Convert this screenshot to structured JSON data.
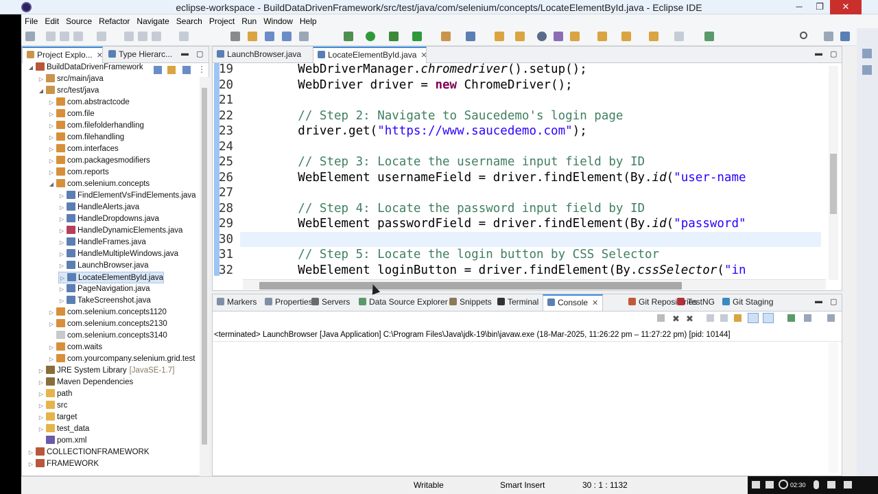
{
  "window": {
    "title": "eclipse-workspace - BuildDataDrivenFramework/src/test/java/com/selenium/concepts/LocateElementById.java - Eclipse IDE",
    "min": "─",
    "restore": "❐",
    "close": "✕"
  },
  "menu": [
    "File",
    "Edit",
    "Source",
    "Refactor",
    "Navigate",
    "Search",
    "Project",
    "Run",
    "Window",
    "Help"
  ],
  "left_panel": {
    "tabs": [
      {
        "label": "Project Explo...",
        "close": "✕"
      },
      {
        "label": "Type Hierarc..."
      }
    ],
    "tree": [
      {
        "label": "BuildDataDrivenFramework",
        "indent": 0,
        "twisty": "◢",
        "icon": "#b8573a"
      },
      {
        "label": "src/main/java",
        "indent": 1,
        "twisty": "▷",
        "icon": "#c9954a"
      },
      {
        "label": "src/test/java",
        "indent": 1,
        "twisty": "◢",
        "icon": "#c9954a"
      },
      {
        "label": "com.abstractcode",
        "indent": 2,
        "twisty": "▷",
        "icon": "#d88f3a"
      },
      {
        "label": "com.file",
        "indent": 2,
        "twisty": "▷",
        "icon": "#d88f3a"
      },
      {
        "label": "com.filefolderhandling",
        "indent": 2,
        "twisty": "▷",
        "icon": "#d88f3a"
      },
      {
        "label": "com.filehandling",
        "indent": 2,
        "twisty": "▷",
        "icon": "#d88f3a"
      },
      {
        "label": "com.interfaces",
        "indent": 2,
        "twisty": "▷",
        "icon": "#d88f3a"
      },
      {
        "label": "com.packagesmodifiers",
        "indent": 2,
        "twisty": "▷",
        "icon": "#d88f3a"
      },
      {
        "label": "com.reports",
        "indent": 2,
        "twisty": "▷",
        "icon": "#d88f3a"
      },
      {
        "label": "com.selenium.concepts",
        "indent": 2,
        "twisty": "◢",
        "icon": "#d88f3a"
      },
      {
        "label": "FindElementVsFindElements.java",
        "indent": 3,
        "twisty": "▷",
        "icon": "#5b7fb5"
      },
      {
        "label": "HandleAlerts.java",
        "indent": 3,
        "twisty": "▷",
        "icon": "#5b7fb5"
      },
      {
        "label": "HandleDropdowns.java",
        "indent": 3,
        "twisty": "▷",
        "icon": "#5b7fb5"
      },
      {
        "label": "HandleDynamicElements.java",
        "indent": 3,
        "twisty": "▷",
        "icon": "#b5405b"
      },
      {
        "label": "HandleFrames.java",
        "indent": 3,
        "twisty": "▷",
        "icon": "#5b7fb5"
      },
      {
        "label": "HandleMultipleWindows.java",
        "indent": 3,
        "twisty": "▷",
        "icon": "#5b7fb5"
      },
      {
        "label": "LaunchBrowser.java",
        "indent": 3,
        "twisty": "▷",
        "icon": "#5b7fb5"
      },
      {
        "label": "LocateElementById.java",
        "indent": 3,
        "twisty": "▷",
        "icon": "#5b7fb5",
        "selected": true
      },
      {
        "label": "PageNavigation.java",
        "indent": 3,
        "twisty": "▷",
        "icon": "#5b7fb5"
      },
      {
        "label": "TakeScreenshot.java",
        "indent": 3,
        "twisty": "▷",
        "icon": "#5b7fb5"
      },
      {
        "label": "com.selenium.concepts1120",
        "indent": 2,
        "twisty": "▷",
        "icon": "#d88f3a"
      },
      {
        "label": "com.selenium.concepts2130",
        "indent": 2,
        "twisty": "▷",
        "icon": "#d88f3a"
      },
      {
        "label": "com.selenium.concepts3140",
        "indent": 2,
        "twisty": "",
        "icon": "#c9c9c9"
      },
      {
        "label": "com.waits",
        "indent": 2,
        "twisty": "▷",
        "icon": "#d88f3a"
      },
      {
        "label": "com.yourcompany.selenium.grid.test",
        "indent": 2,
        "twisty": "▷",
        "icon": "#d88f3a"
      },
      {
        "label": "JRE System Library",
        "dim": "[JavaSE-1.7]",
        "indent": 1,
        "twisty": "▷",
        "icon": "#8a6d3b"
      },
      {
        "label": "Maven Dependencies",
        "indent": 1,
        "twisty": "▷",
        "icon": "#8a6d3b"
      },
      {
        "label": "path",
        "indent": 1,
        "twisty": "▷",
        "icon": "#e6b44a"
      },
      {
        "label": "src",
        "indent": 1,
        "twisty": "▷",
        "icon": "#e6b44a"
      },
      {
        "label": "target",
        "indent": 1,
        "twisty": "▷",
        "icon": "#e6b44a"
      },
      {
        "label": "test_data",
        "indent": 1,
        "twisty": "▷",
        "icon": "#e6b44a"
      },
      {
        "label": "pom.xml",
        "indent": 1,
        "twisty": "",
        "icon": "#6a5aa8"
      },
      {
        "label": "COLLECTIONFRAMEWORK",
        "indent": 0,
        "twisty": "▷",
        "icon": "#b8573a"
      },
      {
        "label": "FRAMEWORK",
        "indent": 0,
        "twisty": "▷",
        "icon": "#b8573a"
      }
    ]
  },
  "editor": {
    "tabs": [
      {
        "label": "LaunchBrowser.java"
      },
      {
        "label": "LocateElementById.java",
        "close": "✕"
      }
    ],
    "lines": [
      {
        "num": "19",
        "parts": [
          {
            "t": "        WebDriverManager."
          },
          {
            "t": "chromedriver",
            "c": "ital"
          },
          {
            "t": "().setup();"
          }
        ]
      },
      {
        "num": "20",
        "parts": [
          {
            "t": "        WebDriver driver = "
          },
          {
            "t": "new",
            "c": "kw"
          },
          {
            "t": " ChromeDriver();"
          }
        ]
      },
      {
        "num": "21",
        "parts": [
          {
            "t": ""
          }
        ]
      },
      {
        "num": "22",
        "parts": [
          {
            "t": "        "
          },
          {
            "t": "// Step 2: Navigate to Saucedemo's login page",
            "c": "comment"
          }
        ]
      },
      {
        "num": "23",
        "parts": [
          {
            "t": "        driver.get("
          },
          {
            "t": "\"https://www.saucedemo.com\"",
            "c": "str"
          },
          {
            "t": ");"
          }
        ]
      },
      {
        "num": "24",
        "parts": [
          {
            "t": ""
          }
        ]
      },
      {
        "num": "25",
        "parts": [
          {
            "t": "        "
          },
          {
            "t": "// Step 3: Locate the username input field by ID",
            "c": "comment"
          }
        ]
      },
      {
        "num": "26",
        "parts": [
          {
            "t": "        WebElement usernameField = driver.findElement(By."
          },
          {
            "t": "id",
            "c": "ital"
          },
          {
            "t": "("
          },
          {
            "t": "\"user-name",
            "c": "str"
          }
        ]
      },
      {
        "num": "27",
        "parts": [
          {
            "t": ""
          }
        ]
      },
      {
        "num": "28",
        "parts": [
          {
            "t": "        "
          },
          {
            "t": "// Step 4: Locate the password input field by ID",
            "c": "comment"
          }
        ]
      },
      {
        "num": "29",
        "parts": [
          {
            "t": "        WebElement passwordField = driver.findElement(By."
          },
          {
            "t": "id",
            "c": "ital"
          },
          {
            "t": "("
          },
          {
            "t": "\"password\"",
            "c": "str"
          }
        ]
      },
      {
        "num": "30",
        "parts": [
          {
            "t": ""
          }
        ],
        "current": true
      },
      {
        "num": "31",
        "parts": [
          {
            "t": "        "
          },
          {
            "t": "// Step 5: Locate the login button by CSS Selector",
            "c": "comment"
          }
        ]
      },
      {
        "num": "32",
        "parts": [
          {
            "t": "        WebElement loginButton = driver.findElement(By."
          },
          {
            "t": "cssSelector",
            "c": "ital"
          },
          {
            "t": "("
          },
          {
            "t": "\"in",
            "c": "str"
          }
        ]
      }
    ]
  },
  "bottom_panel": {
    "tabs": [
      {
        "label": "Markers"
      },
      {
        "label": "Properties"
      },
      {
        "label": "Servers"
      },
      {
        "label": "Data Source Explorer"
      },
      {
        "label": "Snippets"
      },
      {
        "label": "Terminal"
      },
      {
        "label": "Console",
        "close": "✕",
        "active": true
      },
      {
        "label": "Git Repositories"
      },
      {
        "label": "TestNG"
      },
      {
        "label": "Git Staging"
      }
    ],
    "console_header": "<terminated> LaunchBrowser [Java Application] C:\\Program Files\\Java\\jdk-19\\bin\\javaw.exe  (18-Mar-2025, 11:26:22 pm – 11:27:22 pm) [pid: 10144]"
  },
  "status": {
    "writable": "Writable",
    "insert_mode": "Smart Insert",
    "position": "30 : 1 : 1132"
  },
  "tray": {
    "time": "02:30"
  },
  "colors": {
    "accent": "#3d8ee0",
    "comment": "#3f7f5f",
    "keyword": "#7f0055",
    "string": "#2a00ff"
  }
}
